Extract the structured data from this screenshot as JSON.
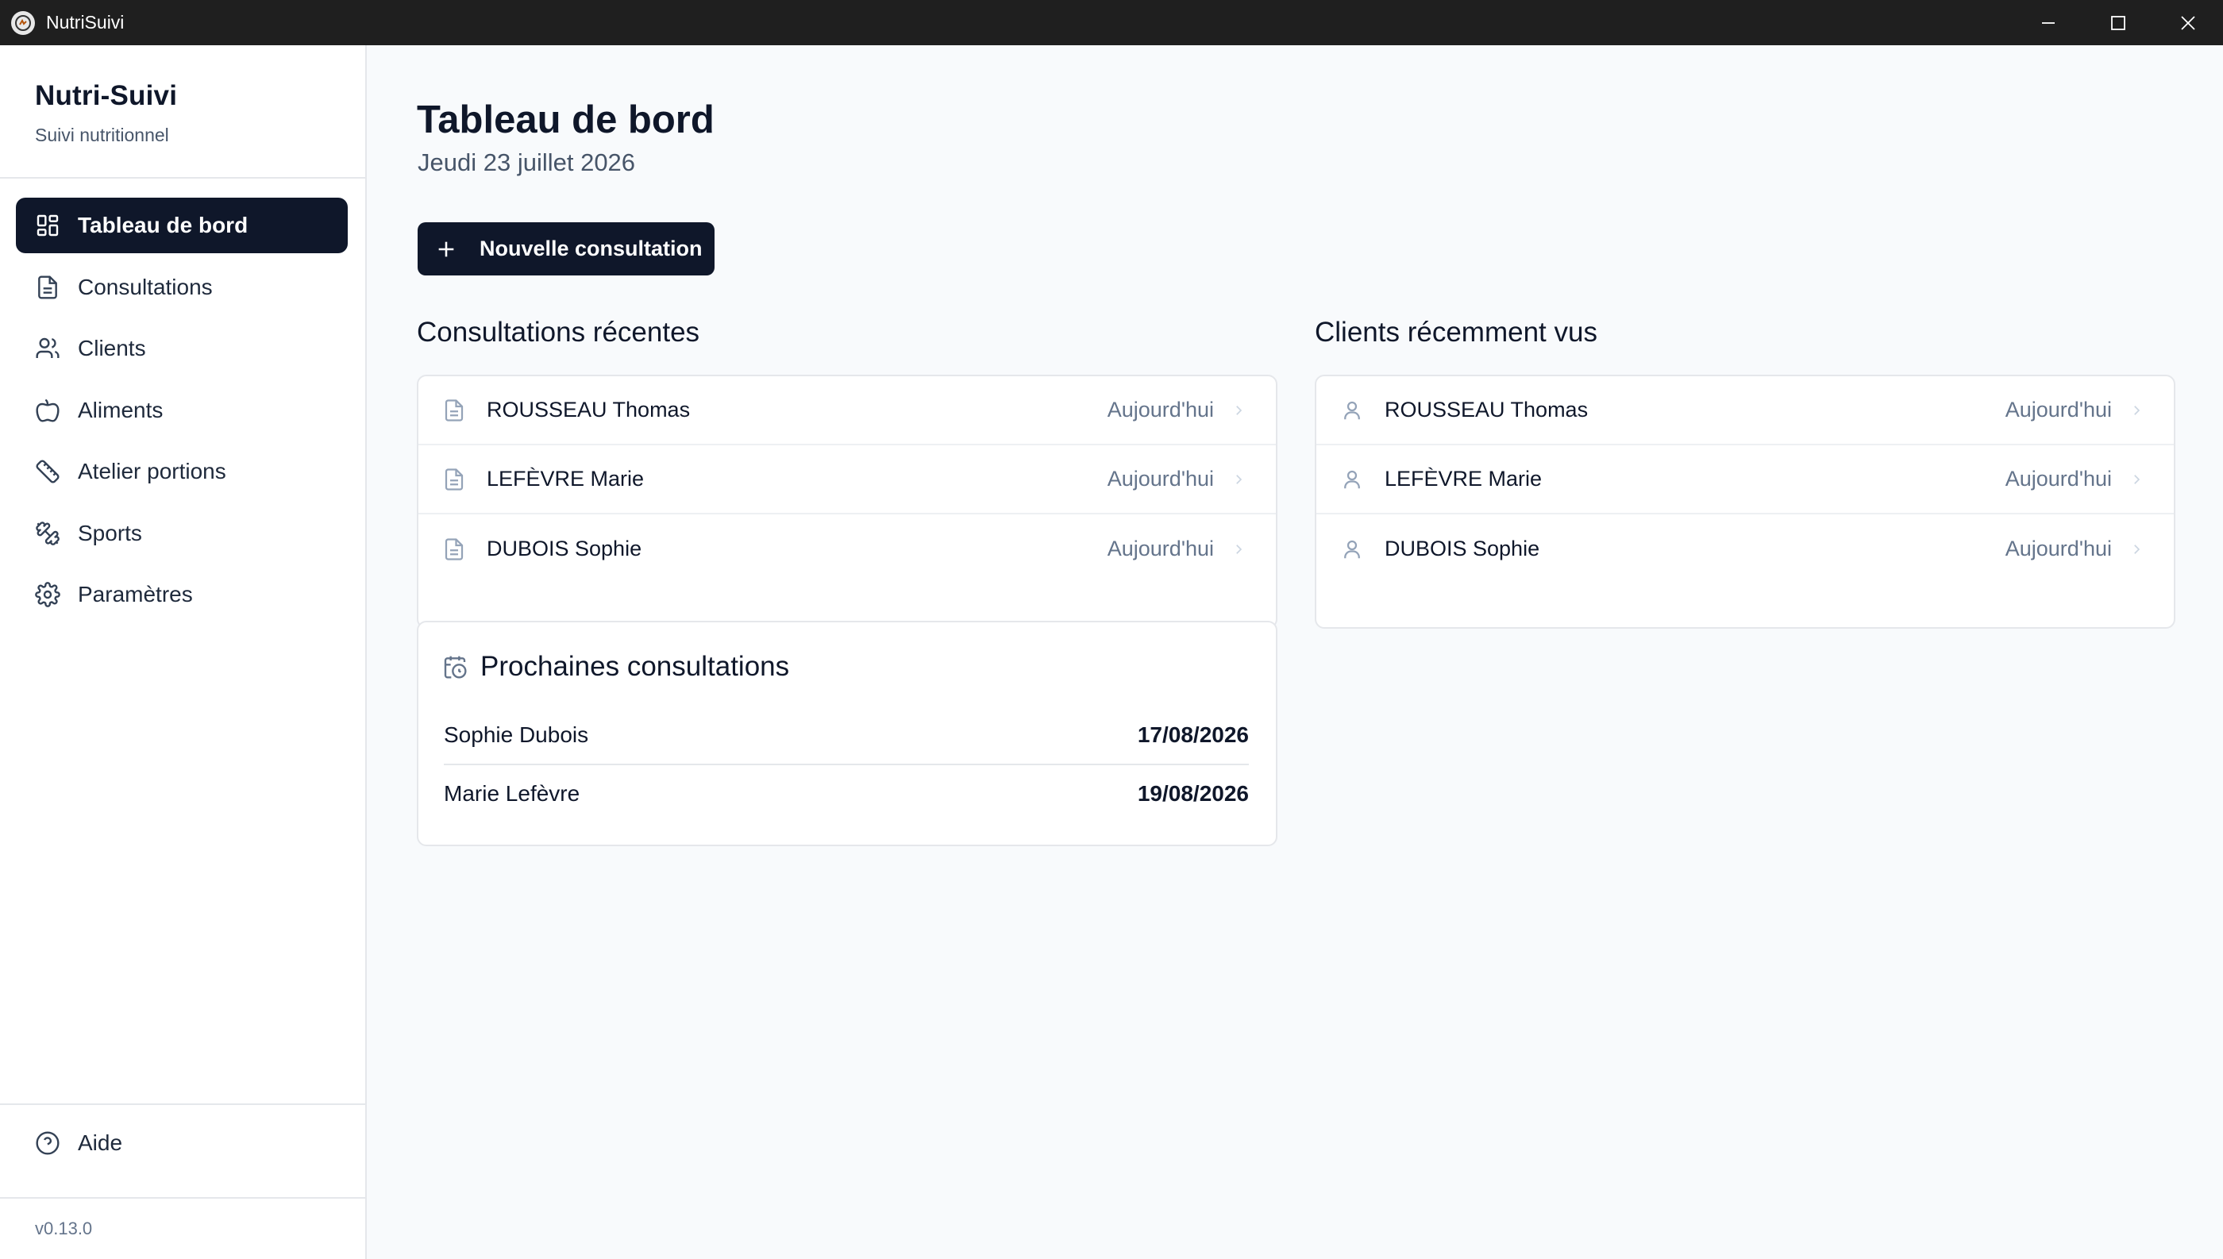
{
  "window": {
    "title": "NutriSuivi"
  },
  "sidebar": {
    "brand": "Nutri-Suivi",
    "subtitle": "Suivi nutritionnel",
    "items": [
      {
        "label": "Tableau de bord",
        "icon": "dashboard-icon",
        "active": true
      },
      {
        "label": "Consultations",
        "icon": "document-icon"
      },
      {
        "label": "Clients",
        "icon": "users-icon"
      },
      {
        "label": "Aliments",
        "icon": "apple-icon"
      },
      {
        "label": "Atelier portions",
        "icon": "ruler-icon"
      },
      {
        "label": "Sports",
        "icon": "dumbbell-icon"
      },
      {
        "label": "Paramètres",
        "icon": "gear-icon"
      }
    ],
    "help": "Aide",
    "version": "v0.13.0"
  },
  "main": {
    "title": "Tableau de bord",
    "date": "Jeudi 23 juillet 2026",
    "new_button": "Nouvelle consultation",
    "recent_consultations": {
      "title": "Consultations récentes",
      "rows": [
        {
          "name": "ROUSSEAU Thomas",
          "when": "Aujourd'hui"
        },
        {
          "name": "LEFÈVRE Marie",
          "when": "Aujourd'hui"
        },
        {
          "name": "DUBOIS Sophie",
          "when": "Aujourd'hui"
        }
      ]
    },
    "recent_clients": {
      "title": "Clients récemment vus",
      "rows": [
        {
          "name": "ROUSSEAU Thomas",
          "when": "Aujourd'hui"
        },
        {
          "name": "LEFÈVRE Marie",
          "when": "Aujourd'hui"
        },
        {
          "name": "DUBOIS Sophie",
          "when": "Aujourd'hui"
        }
      ]
    },
    "upcoming": {
      "title": "Prochaines consultations",
      "rows": [
        {
          "name": "Sophie Dubois",
          "date": "17/08/2026"
        },
        {
          "name": "Marie Lefèvre",
          "date": "19/08/2026"
        }
      ]
    }
  },
  "colors": {
    "primary": "#0f172a",
    "sidebar_bg": "#ffffff",
    "main_bg": "#f8fafc",
    "border": "#e5e7eb",
    "muted_text": "#64748b",
    "titlebar": "#1f1f1f"
  }
}
